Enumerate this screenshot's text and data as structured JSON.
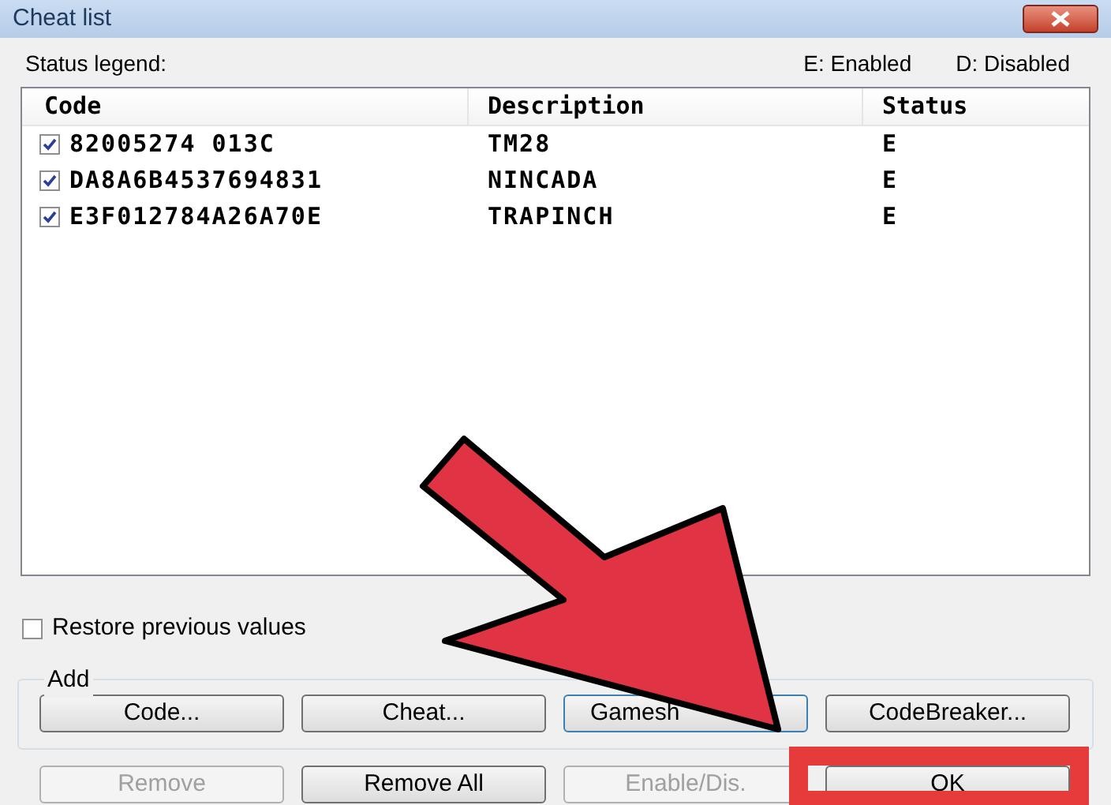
{
  "window": {
    "title": "Cheat list"
  },
  "legend": {
    "label": "Status legend:",
    "items": [
      "E: Enabled",
      "D: Disabled"
    ]
  },
  "table": {
    "columns": [
      "Code",
      "Description",
      "Status"
    ],
    "rows": [
      {
        "checked": true,
        "cells": [
          "82005274 013C",
          "TM28",
          "E"
        ]
      },
      {
        "checked": true,
        "cells": [
          "DA8A6B4537694831",
          "NINCADA",
          "E"
        ]
      },
      {
        "checked": true,
        "cells": [
          "E3F012784A26A70E",
          "TRAPINCH",
          "E"
        ]
      }
    ]
  },
  "restore": {
    "label": "Restore previous values",
    "checked": false
  },
  "add_group": {
    "label": "Add",
    "buttons": [
      {
        "label": "Code...",
        "focused": false
      },
      {
        "label": "Cheat...",
        "focused": false
      },
      {
        "label": "Gamesh",
        "focused": true
      },
      {
        "label": "CodeBreaker...",
        "focused": false
      }
    ]
  },
  "bottom_buttons": [
    {
      "label": "Remove",
      "disabled": true,
      "highlighted": false
    },
    {
      "label": "Remove All",
      "disabled": false,
      "highlighted": false
    },
    {
      "label": "Enable/Dis.",
      "disabled": true,
      "highlighted": false
    },
    {
      "label": "OK",
      "disabled": false,
      "highlighted": true
    }
  ]
}
